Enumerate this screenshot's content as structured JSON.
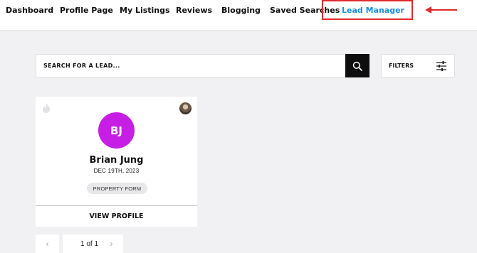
{
  "nav": {
    "items": [
      {
        "label": "Dashboard"
      },
      {
        "label": "Profile Page"
      },
      {
        "label": "My Listings"
      },
      {
        "label": "Reviews"
      },
      {
        "label": "Blogging"
      },
      {
        "label": "Saved Searches"
      },
      {
        "label": "Lead Manager",
        "active": true
      }
    ],
    "active_color": "#1a8fe3",
    "highlight_color": "#e02b2b"
  },
  "search": {
    "placeholder": "SEARCH FOR A LEAD...",
    "button_icon": "search-icon"
  },
  "filters": {
    "label": "FILTERS",
    "icon": "sliders-icon"
  },
  "lead_card": {
    "initials": "BJ",
    "name": "Brian Jung",
    "date": "DEC 19TH, 2023",
    "tag": "PROPERTY FORM",
    "action_label": "VIEW PROFILE",
    "avatar_color": "#c71ee6",
    "status_icon": "fire-icon"
  },
  "pagination": {
    "text": "1 of 1",
    "prev_icon": "chevron-left-icon",
    "next_icon": "chevron-right-icon"
  }
}
